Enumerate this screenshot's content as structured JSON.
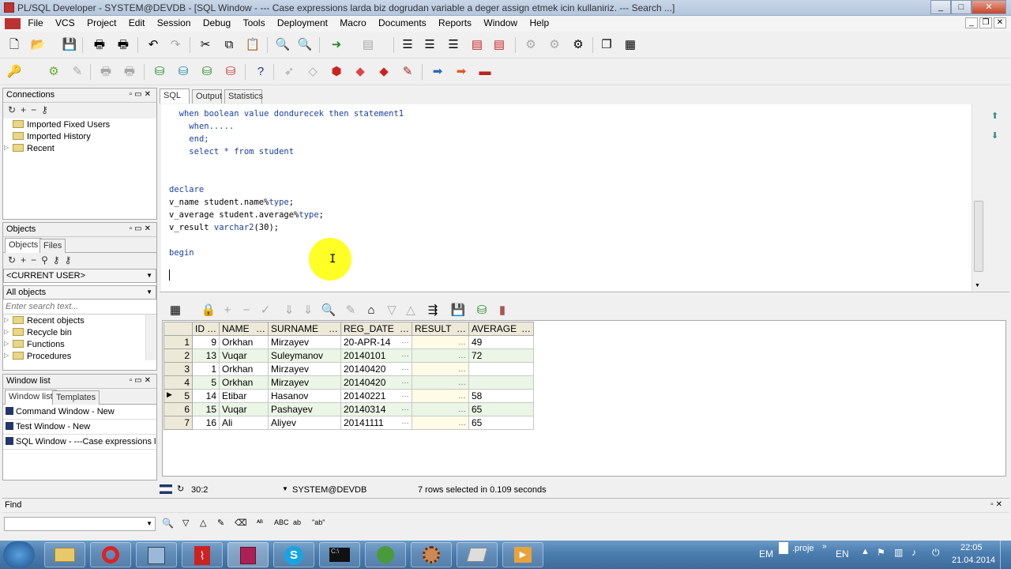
{
  "window": {
    "title": "PL/SQL Developer - SYSTEM@DEVDB - [SQL Window - --- Case expressions larda biz dogrudan variable a deger assign etmek icin kullaniriz. --- Search ...]",
    "min": "_",
    "max": "□",
    "close": "✕"
  },
  "menu": [
    "File",
    "VCS",
    "Project",
    "Edit",
    "Session",
    "Debug",
    "Tools",
    "Deployment",
    "Macro",
    "Documents",
    "Reports",
    "Window",
    "Help"
  ],
  "connections": {
    "title": "Connections",
    "items": [
      "Imported Fixed Users",
      "Imported History",
      "Recent"
    ]
  },
  "objects": {
    "title": "Objects",
    "tabs": [
      "Objects",
      "Files"
    ],
    "user": "<CURRENT USER>",
    "filter": "All objects",
    "search_placeholder": "Enter search text...",
    "items": [
      "Recent objects",
      "Recycle bin",
      "Functions",
      "Procedures"
    ]
  },
  "windowlist": {
    "title": "Window list",
    "tabs": [
      "Window list",
      "Templates"
    ],
    "items": [
      "Command Window - New",
      "Test Window - New",
      "SQL Window - ---Case expressions larda"
    ]
  },
  "editor_tabs": [
    "SQL",
    "Output",
    "Statistics"
  ],
  "code": [
    {
      "indent": "  ",
      "parts": [
        [
          "kw",
          "when boolean value dondurecek then statement1"
        ]
      ]
    },
    {
      "indent": "    ",
      "parts": [
        [
          "kw",
          "when....."
        ]
      ]
    },
    {
      "indent": "    ",
      "parts": [
        [
          "kw",
          "end;"
        ]
      ]
    },
    {
      "indent": "    ",
      "parts": [
        [
          "kw",
          "select * from student"
        ]
      ]
    },
    {
      "indent": "",
      "parts": []
    },
    {
      "indent": "",
      "parts": []
    },
    {
      "indent": "",
      "parts": [
        [
          "kw",
          "declare"
        ]
      ]
    },
    {
      "indent": "",
      "parts": [
        [
          "",
          "v_name student.name%"
        ],
        [
          "kw",
          "type"
        ],
        [
          "",
          ";"
        ]
      ]
    },
    {
      "indent": "",
      "parts": [
        [
          "",
          "v_average student.average%"
        ],
        [
          "kw",
          "type"
        ],
        [
          "",
          ";"
        ]
      ]
    },
    {
      "indent": "",
      "parts": [
        [
          "",
          "v_result "
        ],
        [
          "kw",
          "varchar2"
        ],
        [
          "",
          "(30);"
        ]
      ]
    },
    {
      "indent": "",
      "parts": []
    },
    {
      "indent": "",
      "parts": [
        [
          "kw",
          "begin"
        ]
      ]
    }
  ],
  "grid": {
    "columns": [
      "ID",
      "NAME",
      "SURNAME",
      "REG_DATE",
      "RESULT",
      "AVERAGE"
    ],
    "rows": [
      [
        "1",
        "9",
        "Orkhan",
        "Mirzayev",
        "20-APR-14",
        "",
        "49"
      ],
      [
        "2",
        "13",
        "Vuqar",
        "Suleymanov",
        "20140101",
        "",
        "72"
      ],
      [
        "3",
        "1",
        "Orkhan",
        "Mirzayev",
        "20140420",
        "",
        ""
      ],
      [
        "4",
        "5",
        "Orkhan",
        "Mirzayev",
        "20140420",
        "",
        ""
      ],
      [
        "5",
        "14",
        "Etibar",
        "Hasanov",
        "20140221",
        "",
        "58"
      ],
      [
        "6",
        "15",
        "Vuqar",
        "Pashayev",
        "20140314",
        "",
        "65"
      ],
      [
        "7",
        "16",
        "Ali",
        "Aliyev",
        "20141111",
        "",
        "65"
      ]
    ],
    "current_row": 5
  },
  "status": {
    "position": "30:2",
    "connection": "SYSTEM@DEVDB",
    "message": "7 rows selected in 0.109 seconds"
  },
  "find": {
    "label": "Find"
  },
  "tray": {
    "lang": "EM",
    "project": ".proje",
    "lang2": "EN",
    "time": "22:05",
    "date": "21.04.2014"
  },
  "colors": {
    "keyword": "#1a3fa0",
    "cursor_highlight": "#ffff00"
  }
}
